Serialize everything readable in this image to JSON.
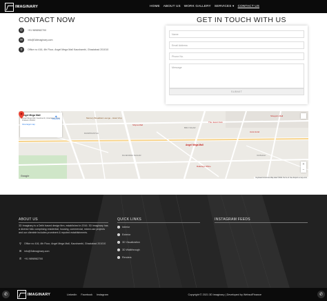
{
  "header": {
    "logo_text": "IMAGINARY",
    "nav": [
      {
        "label": "HOME"
      },
      {
        "label": "ABOUT US"
      },
      {
        "label": "WORK GALLERY"
      },
      {
        "label": "SERVICES ▾"
      },
      {
        "label": "CONTACT US"
      }
    ]
  },
  "contact": {
    "title": "CONTACT NOW",
    "phone": "+91 9898982700",
    "email": "info@3dimaginary.com",
    "address": "Office no 416, 4th Floor, Angel Mega Mall Kaushambi, Ghaziabad 201010"
  },
  "touch": {
    "title": "GET IN TOUCH WITH US",
    "name_placeholder": "Name",
    "email_placeholder": "Email Address",
    "phone_placeholder": "Phone No.",
    "message_placeholder": "Message",
    "submit_label": "SUBMIT"
  },
  "map": {
    "card_title": "Angel Mega Mall",
    "card_address": "Angel Mega Mall, Kaushambi, Ghaziabad, Uttar Pradesh 201010",
    "card_link": "View larger map",
    "directions": "Directions",
    "pin_label": "Angel Mega Mall",
    "labels": {
      "l1": "Mercury Breakfast Lounge - Hotel Vinp",
      "l2": "Shipra Mall",
      "l3": "RAMPRASTHA",
      "l4": "BRIJ VIHAR",
      "l5": "Railways Office",
      "l6": "Aura Hotel",
      "l7": "Shopprix Mall",
      "l8": "The Jewel Club",
      "l9": "RAJENDRA NAGAR",
      "l10": "VAISHALI"
    },
    "zoom_in": "+",
    "zoom_out": "−",
    "google": "Google",
    "attribution": "Keyboard shortcuts   Map data ©2021   Terms of Use   Report a map error"
  },
  "footer": {
    "about_head": "ABOUT US",
    "about_text": "3D Imaginary is a Delhi based design firm, established in 2016. 3D Imaginary has a diverse folio comprising residential, housing, commercial, mixed-use projects and our clientele includes prominent & reputed establishments.",
    "address": "Office no 416, 4th Floor, Angel Mega Mall, Kaushambi, Ghaziabad 201010",
    "email": "info@3dimaginary.com",
    "phone": "+91 9898982700",
    "quick_head": "QUICK LINKS",
    "quick_links": [
      "Interior",
      "Exterior",
      "3D Visualization",
      "3D Walkthrough",
      "Renders"
    ],
    "insta_head": "INSTAGRAM FEEDS"
  },
  "bottom": {
    "logo_text": "IMAGINARY",
    "links": [
      "LinkedIn",
      "Facebook",
      "Instagram"
    ],
    "copyright": "Copyright © 2021 3D imaginary | Developed by WebsolFinance"
  },
  "icons": {
    "phone": "phone-icon",
    "email": "email-icon",
    "location": "location-icon",
    "whatsapp": "whatsapp-icon",
    "call": "call-icon"
  }
}
